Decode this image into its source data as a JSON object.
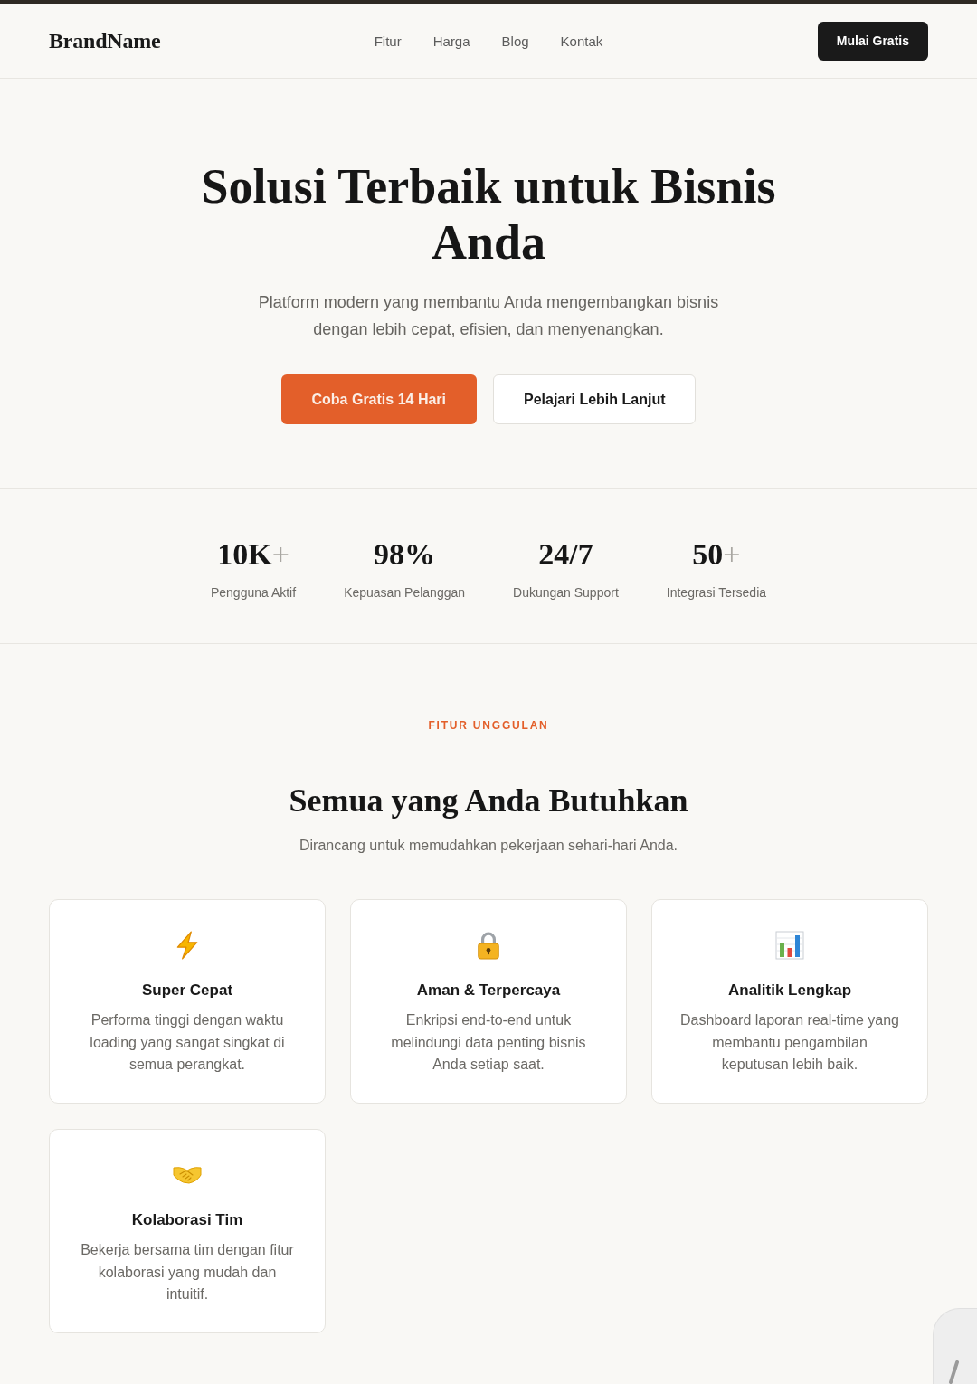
{
  "header": {
    "brand": "BrandName",
    "nav": [
      {
        "label": "Fitur"
      },
      {
        "label": "Harga"
      },
      {
        "label": "Blog"
      },
      {
        "label": "Kontak"
      }
    ],
    "cta": "Mulai Gratis"
  },
  "hero": {
    "title": "Solusi Terbaik untuk Bisnis Anda",
    "subtitle": "Platform modern yang membantu Anda mengembangkan bisnis dengan lebih cepat, efisien, dan menyenangkan.",
    "buttons": [
      {
        "label": "Coba Gratis 14 Hari",
        "kind": "primary"
      },
      {
        "label": "Pelajari Lebih Lanjut",
        "kind": "secondary"
      }
    ]
  },
  "stats": [
    {
      "value": "10K",
      "suffix": "+",
      "label": "Pengguna Aktif"
    },
    {
      "value": "98%",
      "label": "Kepuasan Pelanggan"
    },
    {
      "value": "24/7",
      "label": "Dukungan Support"
    },
    {
      "value": "50",
      "suffix": "+",
      "label": "Integrasi Tersedia"
    }
  ],
  "features": {
    "eyebrow": "FITUR UNGGULAN",
    "title": "Semua yang Anda Butuhkan",
    "subtitle": "Dirancang untuk memudahkan pekerjaan sehari-hari Anda.",
    "cards": [
      {
        "title": "Super Cepat",
        "description": "Performa tinggi dengan waktu loading yang sangat singkat di semua perangkat."
      },
      {
        "title": "Aman & Terpercaya",
        "description": "Enkripsi end-to-end untuk melindungi data penting bisnis Anda setiap saat."
      },
      {
        "title": "Analitik Lengkap",
        "description": "Dashboard laporan real-time yang membantu pengambilan keputusan lebih baik."
      },
      {
        "title": "Kolaborasi Tim",
        "description": "Bekerja bersama tim dengan fitur kolaborasi yang mudah dan intuitif."
      }
    ]
  }
}
